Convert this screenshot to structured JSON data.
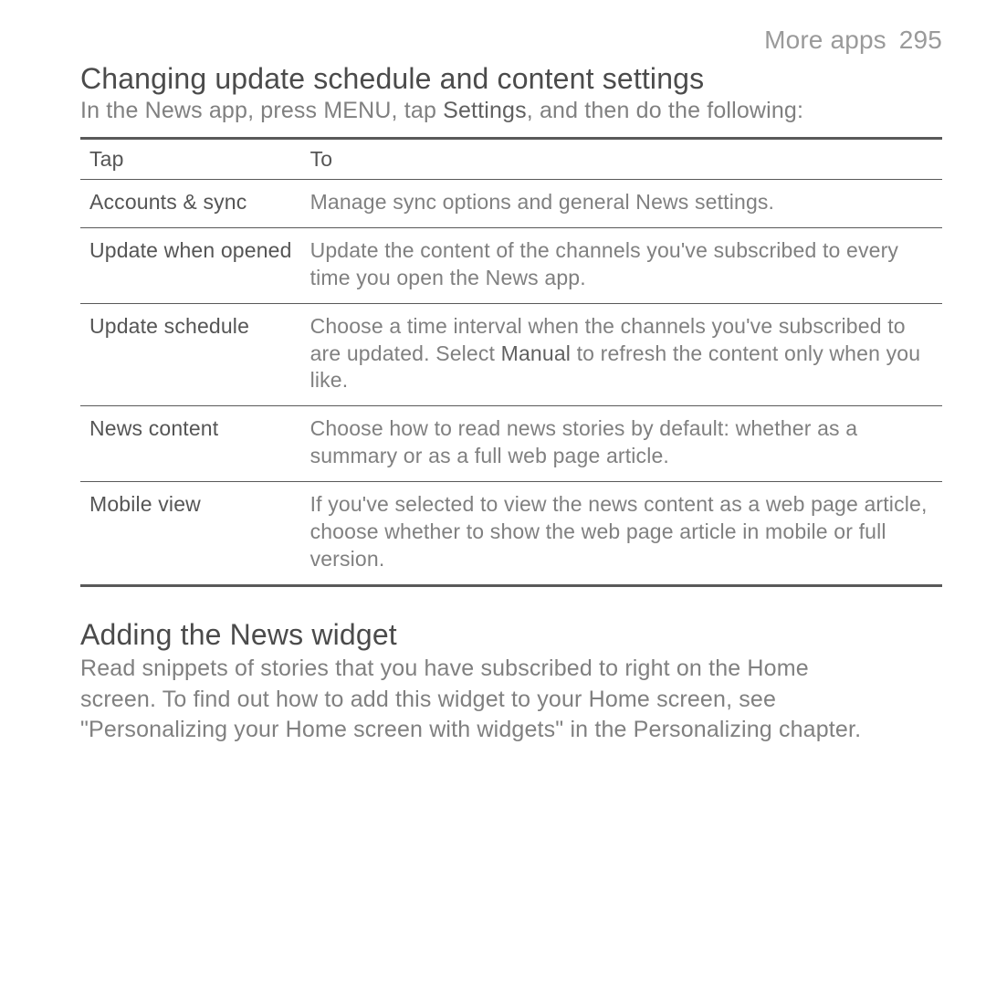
{
  "header": {
    "label": "More apps",
    "page": "295"
  },
  "section1": {
    "title": "Changing update schedule and content settings",
    "intro_before": "In the News app, press MENU, tap ",
    "intro_strong": "Settings",
    "intro_after": ", and then do the following:",
    "th_tap": "Tap",
    "th_to": "To",
    "rows": [
      {
        "tap": "Accounts & sync",
        "to_before": "Manage sync options and general News settings.",
        "to_strong": "",
        "to_after": ""
      },
      {
        "tap": "Update when opened",
        "to_before": "Update the content of the channels you've subscribed to every time you open the News app.",
        "to_strong": "",
        "to_after": ""
      },
      {
        "tap": "Update schedule",
        "to_before": "Choose a time interval when the channels you've subscribed to are updated. Select ",
        "to_strong": "Manual",
        "to_after": " to refresh the content only when you like."
      },
      {
        "tap": "News content",
        "to_before": "Choose how to read news stories by default: whether as a summary or as a full web page article.",
        "to_strong": "",
        "to_after": ""
      },
      {
        "tap": "Mobile view",
        "to_before": "If you've selected to view the news content as a web page article, choose whether to show the web page article in mobile or full version.",
        "to_strong": "",
        "to_after": ""
      }
    ]
  },
  "section2": {
    "title": "Adding the News widget",
    "body": "Read snippets of stories that you have subscribed to right on the Home screen. To find out how to add this widget to your Home screen, see \"Personalizing your Home screen with widgets\" in the Personalizing chapter."
  }
}
